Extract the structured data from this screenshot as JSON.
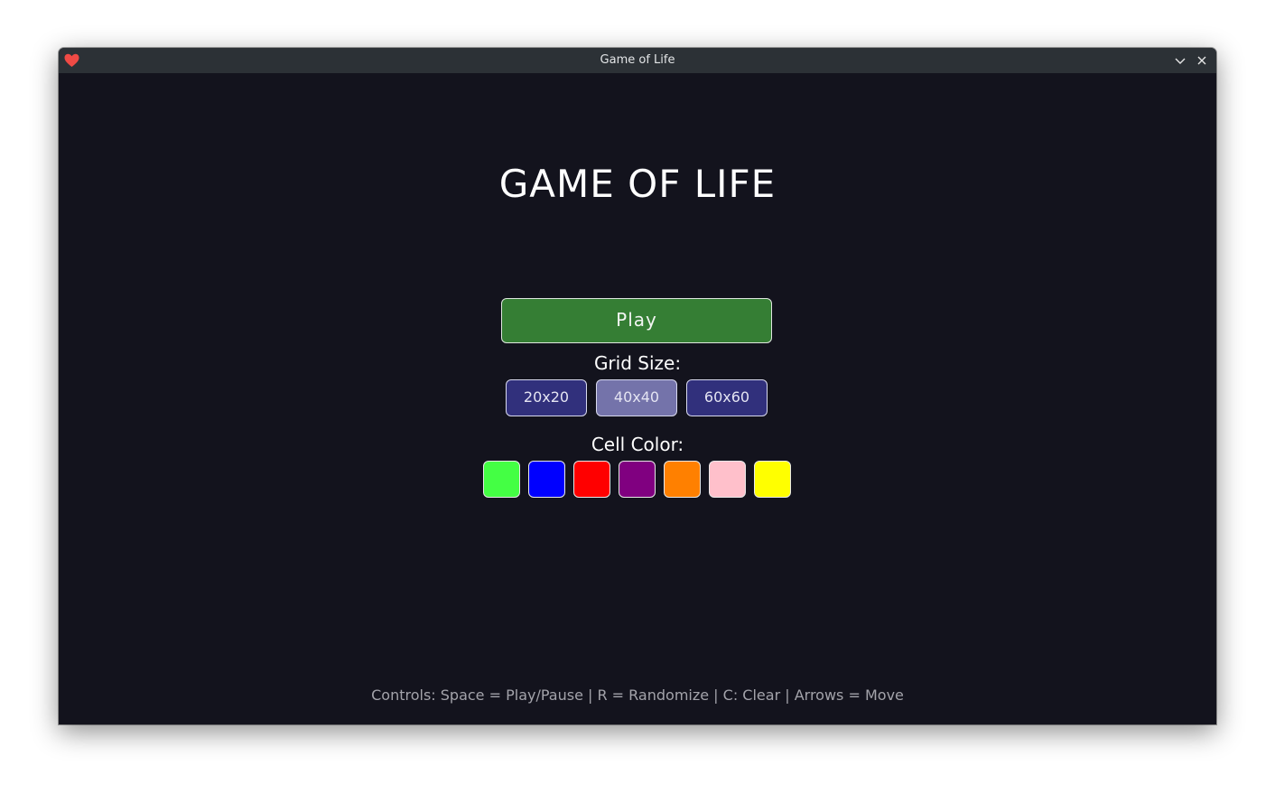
{
  "window": {
    "title": "Game of Life",
    "icons": {
      "app": "heart-icon",
      "minimize": "chevron-down-icon",
      "close": "close-icon"
    }
  },
  "main": {
    "title": "GAME OF LIFE",
    "play_label": "Play",
    "grid_size_label": "Grid Size:",
    "grid_sizes": [
      "20x20",
      "40x40",
      "60x60"
    ],
    "selected_grid_size": "40x40",
    "cell_color_label": "Cell Color:",
    "cell_colors": [
      "#44ff44",
      "#0000ff",
      "#ff0000",
      "#800080",
      "#ff8000",
      "#ffc0cb",
      "#ffff00"
    ],
    "controls_text": "Controls: Space = Play/Pause | R = Randomize | C: Clear | Arrows = Move"
  },
  "theme": {
    "background": "#13131d",
    "play_button": "#357e34",
    "size_button": "#31307c",
    "size_button_selected": "#7473aa"
  }
}
